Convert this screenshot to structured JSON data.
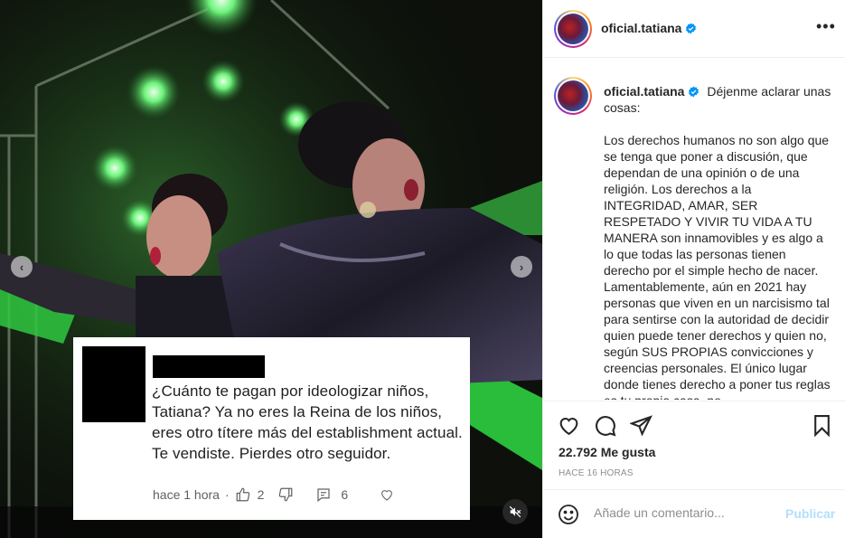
{
  "post": {
    "username": "oficial.tatiana",
    "more_glyph": "•••",
    "caption_intro": "Déjenme aclarar unas cosas:",
    "caption_body": "Los derechos humanos no son algo que se tenga que poner a discusión, que dependan de una opinión o de una religión. Los derechos a la INTEGRIDAD, AMAR, SER RESPETADO Y VIVIR TU VIDA A TU MANERA son innamovibles y es algo a lo que todas las personas tienen derecho por el simple hecho de nacer. Lamentablemente, aún en 2021 hay personas que viven en un narcisismo tal para sentirse con la autoridad de decidir quien puede tener derechos y quien no, según SUS PROPIAS convicciones y creencias personales. El único lugar donde tienes derecho a poner tus reglas es tu propia casa, no",
    "likes": "22.792 Me gusta",
    "timestamp": "HACE 16 HORAS",
    "comment_placeholder": "Añade un comentario...",
    "publish_label": "Publicar"
  },
  "media": {
    "prev_arrow": "‹",
    "next_arrow": "›",
    "overlay_comment": {
      "text": "¿Cuánto te pagan por ideologizar niños, Tatiana? Ya no eres la Reina de los niños, eres otro títere más del establishment actual. Te vendiste. Pierdes otro seguidor.",
      "time": "hace 1 hora",
      "likes": "2",
      "replies": "6"
    }
  },
  "icons": {
    "verified": "verified-badge",
    "like": "heart-icon",
    "comment": "comment-bubble-icon",
    "share": "paper-plane-icon",
    "save": "bookmark-icon",
    "emoji": "smiley-icon",
    "mute": "speaker-muted-icon"
  },
  "colors": {
    "verified": "#0095f6",
    "publish_disabled": "#b2dffc",
    "stage_green": "#33d14a"
  }
}
